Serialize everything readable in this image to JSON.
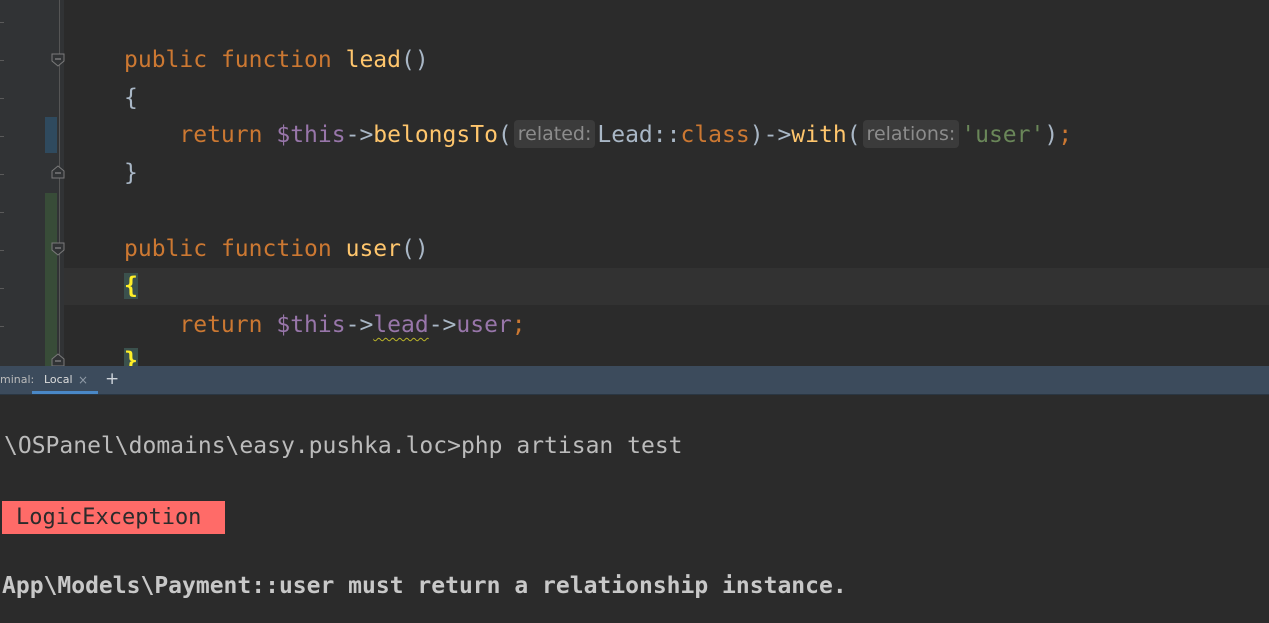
{
  "editor": {
    "lines": {
      "l1": {
        "kw1": "public",
        "kw2": "function",
        "name": "lead",
        "parens": "()"
      },
      "l2": {
        "brace": "{"
      },
      "l3": {
        "kw": "return",
        "var": "$this",
        "arrow1": "->",
        "method1": "belongsTo",
        "paren_open1": "(",
        "hint1": "related:",
        "cls": "Lead::",
        "cls_kw": "class",
        "paren_close1": ")",
        "arrow2": "->",
        "method2": "with",
        "paren_open2": "(",
        "hint2": "relations:",
        "str": "'user'",
        "paren_close2": ")",
        "semi": ";"
      },
      "l4": {
        "brace": "}"
      },
      "l5": {
        "kw1": "public",
        "kw2": "function",
        "name": "user",
        "parens": "()"
      },
      "l6": {
        "brace": "{"
      },
      "l7": {
        "kw": "return",
        "var": "$this",
        "arrow1": "->",
        "prop1": "lead",
        "arrow2": "->",
        "prop2": "user",
        "semi": ";"
      },
      "l8": {
        "brace": "}"
      }
    }
  },
  "terminal": {
    "label": "minal:",
    "tab_label": "Local",
    "tab_close": "×",
    "add_tab": "+",
    "command_line": "\\OSPanel\\domains\\easy.pushka.loc>php artisan test",
    "exception_name": "LogicException",
    "message": "App\\Models\\Payment::user must return a relationship instance."
  },
  "colors": {
    "keyword": "#cc7832",
    "function": "#ffc66d",
    "variable": "#9876aa",
    "string": "#6a8759",
    "exception_bg": "#ff6b68",
    "tab_bar": "#3c4b5c"
  }
}
